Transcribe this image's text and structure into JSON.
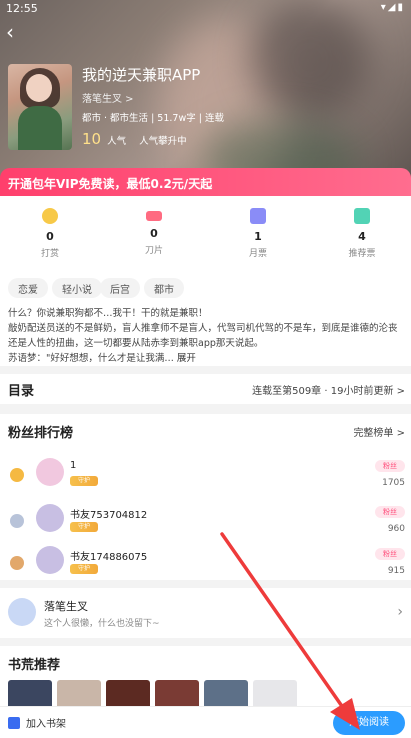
{
  "status": {
    "time": "12:55",
    "icons": "▾◢▮"
  },
  "book": {
    "title": "我的逆天兼职APP",
    "author": "落笔生叉 >",
    "meta": "都市 · 都市生活 | 51.7w字 | 连载",
    "popularity": "10",
    "pop_label": "人气",
    "pop_trend": "人气攀升中"
  },
  "vip_banner": "开通包年VIP免费读，最低0.2元/天起",
  "stats": [
    {
      "value": "0",
      "label": "打赏",
      "color": "#f7c948"
    },
    {
      "value": "0",
      "label": "刀片",
      "color": "#ff6b81"
    },
    {
      "value": "1",
      "label": "月票",
      "color": "#8a8cf7"
    },
    {
      "value": "4",
      "label": "推荐票",
      "color": "#52d3b5"
    }
  ],
  "tags": [
    "恋爱",
    "轻小说",
    "后宫",
    "都市"
  ],
  "description": {
    "line1": "什么？你说兼职狗都不…我干！干的就是兼职！",
    "line2": "敲奶配送员送的不是鲜奶，盲人推拿师不是盲人，代驾司机代驾的不是车，到底是谁德的沦丧还是人性的扭曲，这一切都要从陆赤李到兼职app那天说起。",
    "line3": "苏语梦：\"好好想想，什么才是让我满…",
    "more": "展开"
  },
  "toc": {
    "title": "目录",
    "status": "连载至第509章 · 19小时前更新 >"
  },
  "fans": {
    "title": "粉丝排行榜",
    "link": "完整榜单 >",
    "rows": [
      {
        "name": "1",
        "badge": "守护",
        "fan_badge": "粉丝",
        "score": "1705",
        "medal": "#f5b942",
        "avatar": "#f1c8df"
      },
      {
        "name": "书友753704812",
        "badge": "守护",
        "fan_badge": "粉丝",
        "score": "960",
        "medal": "#b8c3d9",
        "avatar": "#c8bfe3"
      },
      {
        "name": "书友174886075",
        "badge": "守护",
        "fan_badge": "粉丝",
        "score": "915",
        "medal": "#e2a86b",
        "avatar": "#c8bfe3"
      }
    ]
  },
  "author_card": {
    "name": "落笔生叉",
    "signature": "这个人很懒，什么也没留下~"
  },
  "recommend": {
    "title": "书荒推荐",
    "covers": [
      "#3b4660",
      "#c9b6a8",
      "#5c2a22",
      "#7a3b34",
      "#5d7088",
      "#e7e7ea"
    ]
  },
  "bottom": {
    "shelf": "加入书架",
    "read": "开始阅读"
  }
}
